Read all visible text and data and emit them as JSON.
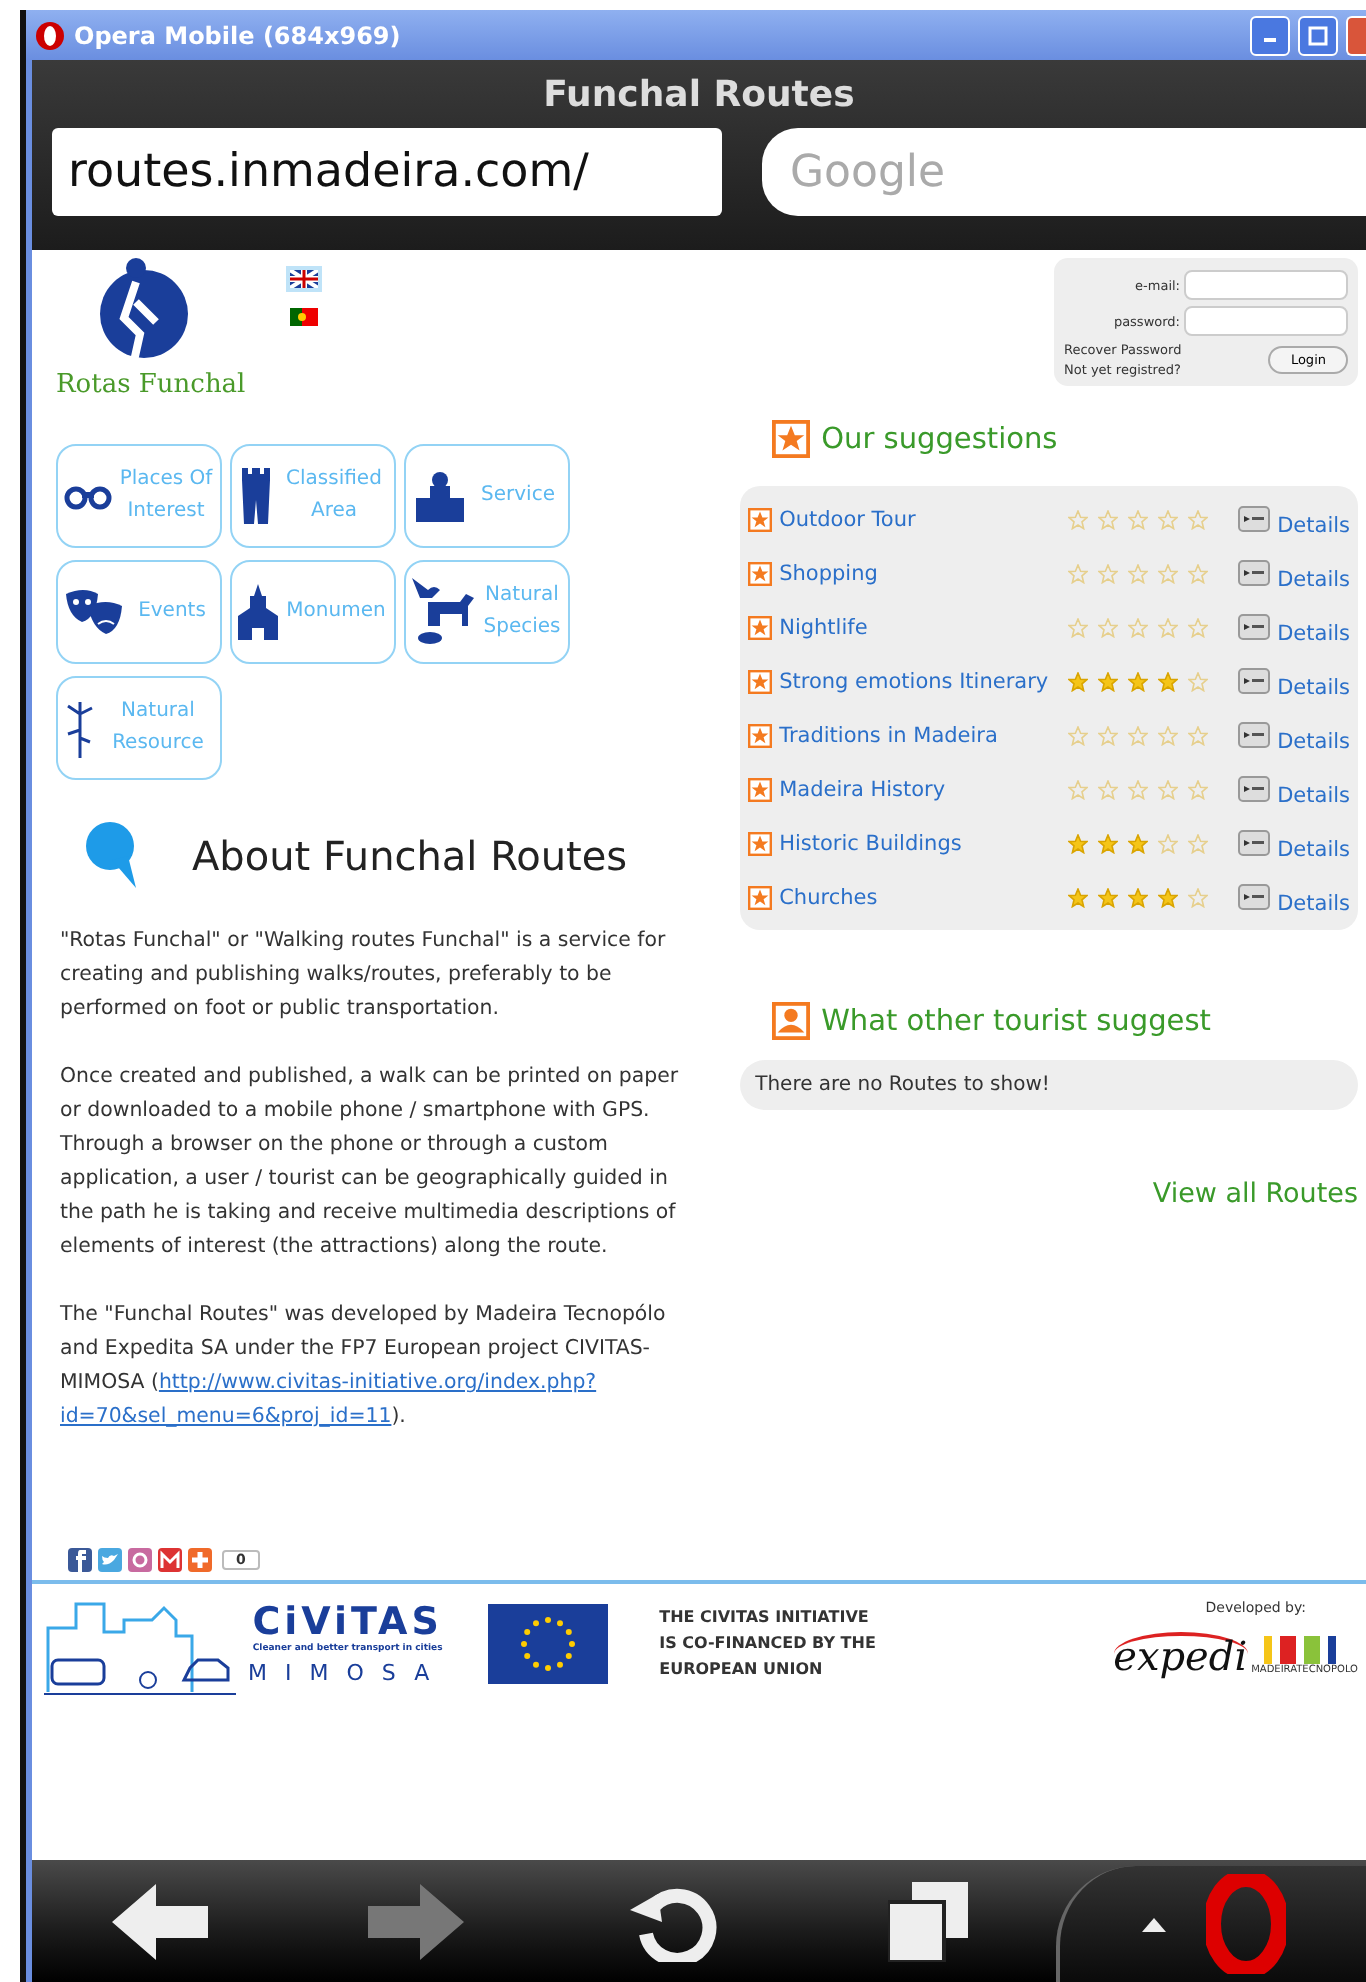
{
  "window": {
    "title": "Opera Mobile (684x969)"
  },
  "browser": {
    "page_title": "Funchal Routes",
    "url": "routes.inmadeira.com/",
    "search_placeholder": "Google"
  },
  "site": {
    "logo_text": "Rotas Funchal",
    "languages": [
      {
        "kind": "uk",
        "selected": true
      },
      {
        "kind": "pt",
        "selected": false
      }
    ],
    "categories": [
      {
        "kind": "binoculars",
        "label": "Places Of Interest"
      },
      {
        "kind": "tower",
        "label": "Classified Area"
      },
      {
        "kind": "service",
        "label": "Service"
      },
      {
        "kind": "masks",
        "label": "Events"
      },
      {
        "kind": "chapel",
        "label": "Monumen"
      },
      {
        "kind": "animals",
        "label": "Natural Species"
      },
      {
        "kind": "plant",
        "label": "Natural Resource"
      }
    ],
    "about": {
      "heading": "About Funchal Routes",
      "paragraphs": [
        "\"Rotas Funchal\" or \"Walking routes Funchal\" is a service for creating and publishing walks/routes, preferably to be performed on foot or public transportation.",
        "Once created and published, a walk can be printed on paper or downloaded to a mobile phone / smartphone with GPS. Through a browser on the phone or through a custom application, a user / tourist can be geographically guided in the path he is taking and receive multimedia descriptions of elements of interest (the attractions) along the route."
      ],
      "credits": {
        "text": "The \"Funchal Routes\" was developed by Madeira Tecnopólo and Expedita SA under the  FP7 European project CIVITAS-MIMOSA (",
        "link_lines": [
          "http://www.civitas-initiative.org/index.php?",
          "id=70&sel_menu=6&proj_id=11"
        ],
        "after": ")."
      }
    },
    "share": {
      "services": [
        {
          "kind": "facebook"
        },
        {
          "kind": "twitter"
        },
        {
          "kind": "circle"
        },
        {
          "kind": "gmail"
        },
        {
          "kind": "plus"
        }
      ],
      "count": "0"
    },
    "login": {
      "email_label": "e-mail:",
      "password_label": "password:",
      "recover": "Recover Password",
      "register": "Not yet registred?",
      "button": "Login"
    },
    "suggestions": {
      "heading": "Our suggestions",
      "items": [
        {
          "name": "Outdoor Tour",
          "stars": 0,
          "details": "Details"
        },
        {
          "name": "Shopping",
          "stars": 0,
          "details": "Details"
        },
        {
          "name": "Nightlife",
          "stars": 0,
          "details": "Details"
        },
        {
          "name": "Strong emotions Itinerary",
          "stars": 4,
          "details": "Details"
        },
        {
          "name": "Traditions in Madeira",
          "stars": 0,
          "details": "Details"
        },
        {
          "name": "Madeira History",
          "stars": 0,
          "details": "Details"
        },
        {
          "name": "Historic Buildings",
          "stars": 3,
          "details": "Details"
        },
        {
          "name": "Churches",
          "stars": 4,
          "details": "Details"
        }
      ]
    },
    "tourist": {
      "heading": "What other tourist suggest",
      "empty": "There are no Routes to show!"
    },
    "view_all": "View all Routes",
    "footer": {
      "civitas": {
        "name": "CiViTAS",
        "tagline": "Cleaner and better transport in cities",
        "project": "MIMOSA"
      },
      "eu_lines": [
        "THE CIVITAS INITIATIVE",
        "IS CO-FINANCED BY THE",
        "EUROPEAN UNION"
      ],
      "developed_by": "Developed by:",
      "expedi": "expedi",
      "tecnopolo": "MADEIRATECNOPOLO"
    }
  },
  "toolbar": [
    {
      "kind": "back",
      "disabled": false
    },
    {
      "kind": "forward",
      "disabled": true
    },
    {
      "kind": "reload",
      "disabled": false
    },
    {
      "kind": "tabs",
      "disabled": false
    },
    {
      "kind": "menu",
      "disabled": false
    }
  ]
}
